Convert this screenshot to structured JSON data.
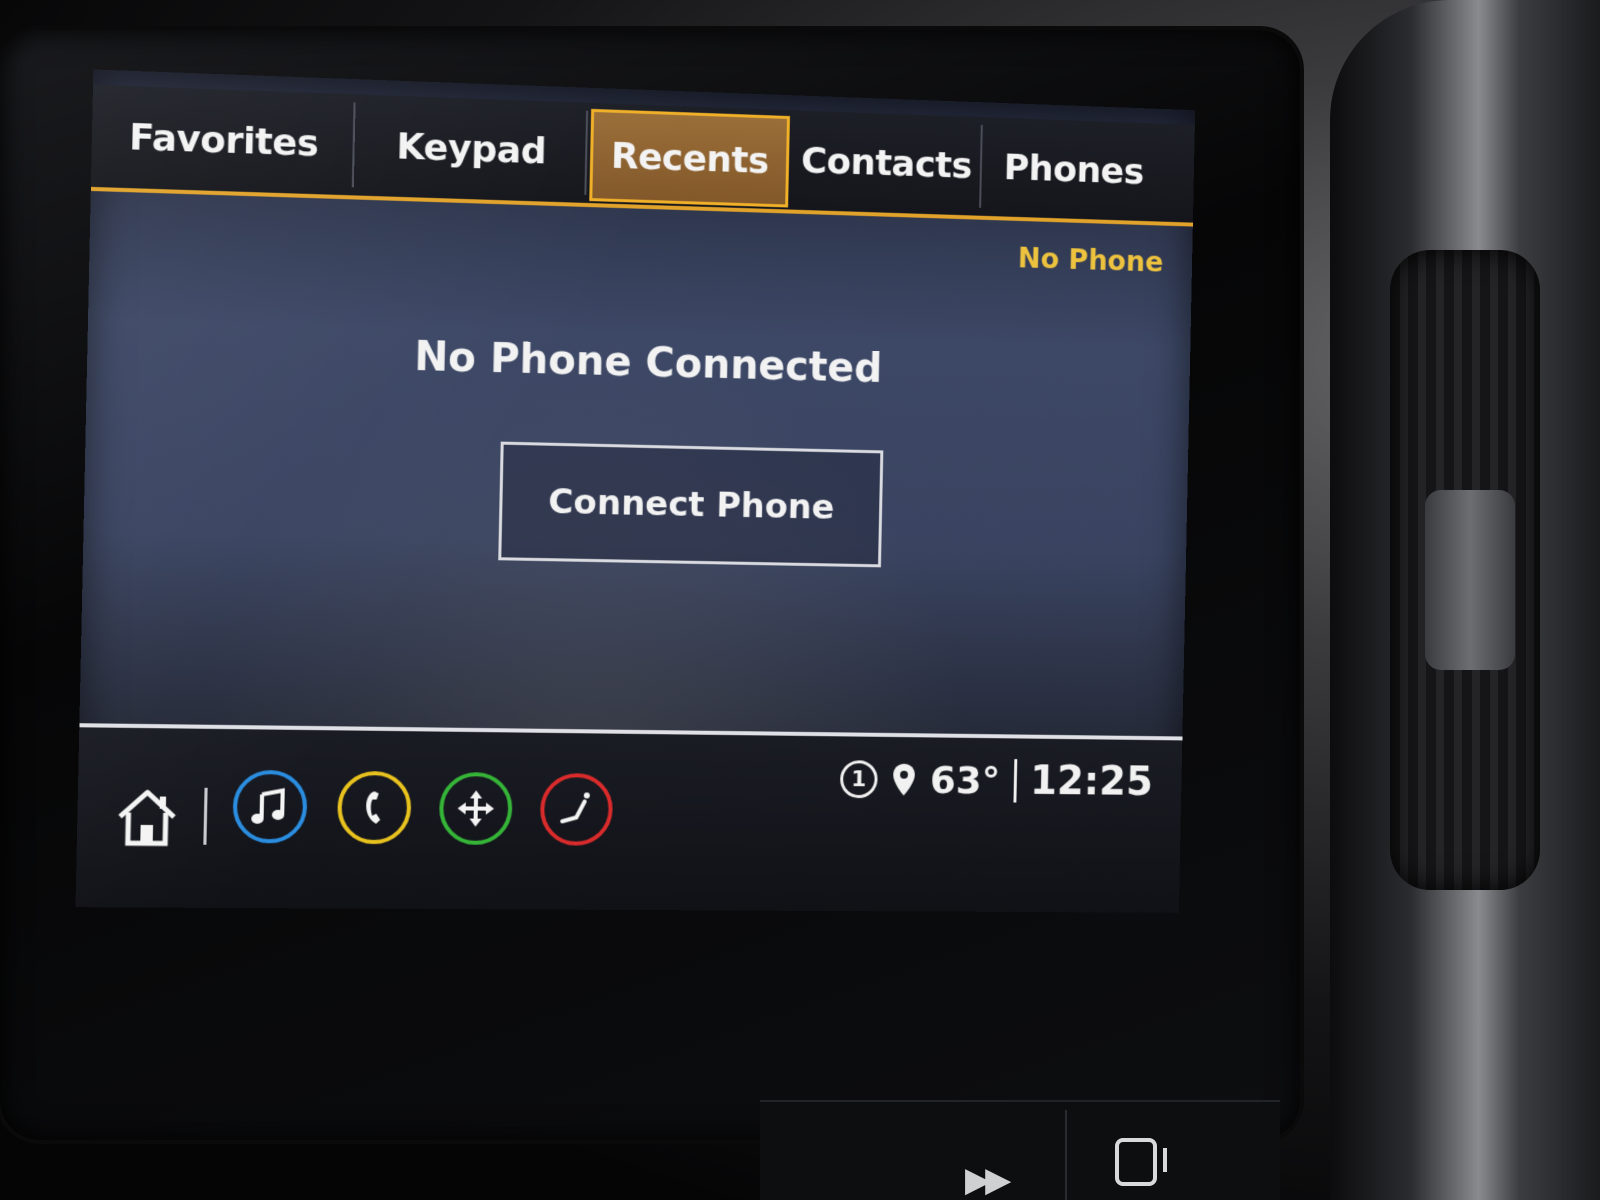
{
  "tabs": [
    {
      "label": "Favorites",
      "active": false
    },
    {
      "label": "Keypad",
      "active": false
    },
    {
      "label": "Recents",
      "active": true
    },
    {
      "label": "Contacts",
      "active": false
    },
    {
      "label": "Phones",
      "active": false
    }
  ],
  "status": {
    "phone_status": "No Phone"
  },
  "main": {
    "message": "No Phone Connected",
    "connect_label": "Connect Phone"
  },
  "bottom_bar": {
    "apps": [
      {
        "icon": "home-icon"
      },
      {
        "icon": "music-icon",
        "ring_color": "#2a8de0"
      },
      {
        "icon": "phone-icon",
        "ring_color": "#e8c21e"
      },
      {
        "icon": "navigation-icon",
        "ring_color": "#35b437"
      },
      {
        "icon": "seat-icon",
        "ring_color": "#d92b2b"
      }
    ],
    "notification_count": "1",
    "temperature": "63°",
    "clock": "12:25"
  },
  "colors": {
    "accent": "#e2a32a",
    "active_tab": "#8f6330",
    "status_text": "#ecc23f"
  }
}
